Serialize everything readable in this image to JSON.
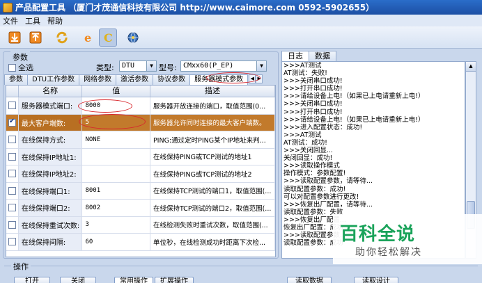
{
  "window": {
    "title": "产品配置工具 （厦门才茂通信科技有限公司  http://www.caimore.com  0592-5902655）"
  },
  "menu": [
    "文件",
    "工具",
    "帮助"
  ],
  "toolbar": {
    "icons": [
      "import-icon",
      "export-icon",
      "refresh-icon",
      "ie-icon",
      "c-logo-icon",
      "globe-icon"
    ]
  },
  "params": {
    "legend": "参数",
    "select_all": "全选",
    "type_label": "类型:",
    "type_value": "DTU",
    "model_label": "型号:",
    "model_value": "CMxx60(P_EP)"
  },
  "tabs": [
    "参数",
    "DTU工作参数",
    "网络参数",
    "激活参数",
    "协议参数",
    "服务器模式参数"
  ],
  "selected_tab": 5,
  "grid": {
    "headers": [
      "名称",
      "值",
      "描述"
    ],
    "rows": [
      {
        "name": "服务器模式端口:",
        "value": "8000",
        "desc": "服务器开放连接的端口，取值范围(0...",
        "checked": false,
        "selected": false
      },
      {
        "name": "最大客户端数:",
        "value": "5",
        "desc": "服务器允许同时连接的最大客户端数。",
        "checked": true,
        "selected": true
      },
      {
        "name": "在线保持方式:",
        "value": "NONE",
        "desc": "PING:通过定时PING某个IP地址来判...",
        "checked": false,
        "selected": false
      },
      {
        "name": "在线保持IP地址1:",
        "value": "",
        "desc": "在线保持PING或TCP测试的地址1",
        "checked": false,
        "selected": false
      },
      {
        "name": "在线保持IP地址2:",
        "value": "",
        "desc": "在线保持PING或TCP测试的地址2",
        "checked": false,
        "selected": false
      },
      {
        "name": "在线保持端口1:",
        "value": "8001",
        "desc": "在线保持TCP测试的端口1，取值范围(...",
        "checked": false,
        "selected": false
      },
      {
        "name": "在线保持端口2:",
        "value": "8002",
        "desc": "在线保持TCP测试的端口2，取值范围(...",
        "checked": false,
        "selected": false
      },
      {
        "name": "在线保持重试次数:",
        "value": "3",
        "desc": "在线检测失败时重试次数，取值范围(...",
        "checked": false,
        "selected": false
      },
      {
        "name": "在线保持间隔:",
        "value": "60",
        "desc": "单位秒，在线检测成功时距离下次检...",
        "checked": false,
        "selected": false
      }
    ]
  },
  "log": {
    "tabs": [
      "日志",
      "数据"
    ],
    "lines": [
      ">>>AT测试",
      "AT测试：失败!",
      ">>>关闭串口成功!",
      ">>>打开串口成功!",
      ">>>请给设备上电!（如果已上电请重新上电!）",
      ">>>关闭串口成功!",
      ">>>打开串口成功!",
      ">>>请给设备上电!（如果已上电请重新上电!）",
      ">>>进入配置状态：成功!",
      ">>>AT测试",
      "AT测试：成功!",
      ">>>关闭回显...",
      "关闭回显：成功!",
      ">>>读取操作模式",
      "操作模式：参数配置!",
      ">>>读取配置参数，请等待...",
      "读取配置参数：成功!",
      "可以对配置参数进行更改!",
      ">>>恢复出厂配置，请等待...",
      "读取配置参数：失败",
      ">>>恢复出厂配置...",
      "恢复出厂配置：成功",
      ">>>读取配置参数...",
      "读取配置参数：成功"
    ]
  },
  "watermark": {
    "title": "百科全说",
    "subtitle": "助你轻松解决"
  },
  "ops": {
    "legend": "操作",
    "buttons": [
      "打开",
      "关闭",
      "常用操作",
      "扩展操作",
      "读取数据",
      "读取设计"
    ]
  }
}
